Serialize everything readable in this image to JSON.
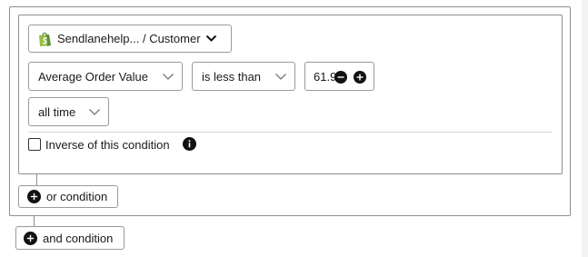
{
  "store_selector": {
    "label": "Sendlanehelp... / Customer",
    "icon": "shopify-icon"
  },
  "metric_select": {
    "value": "Average Order Value"
  },
  "operator_select": {
    "value": "is less than"
  },
  "value_input": {
    "value": "61.9"
  },
  "time_select": {
    "value": "all time"
  },
  "inverse": {
    "label": "Inverse of this condition",
    "checked": false
  },
  "or_condition": {
    "label": "or condition"
  },
  "and_condition": {
    "label": "and condition"
  },
  "colors": {
    "shopify_green": "#95bf47",
    "shopify_dark": "#5e8e3e",
    "icon_fill": "#111111"
  }
}
